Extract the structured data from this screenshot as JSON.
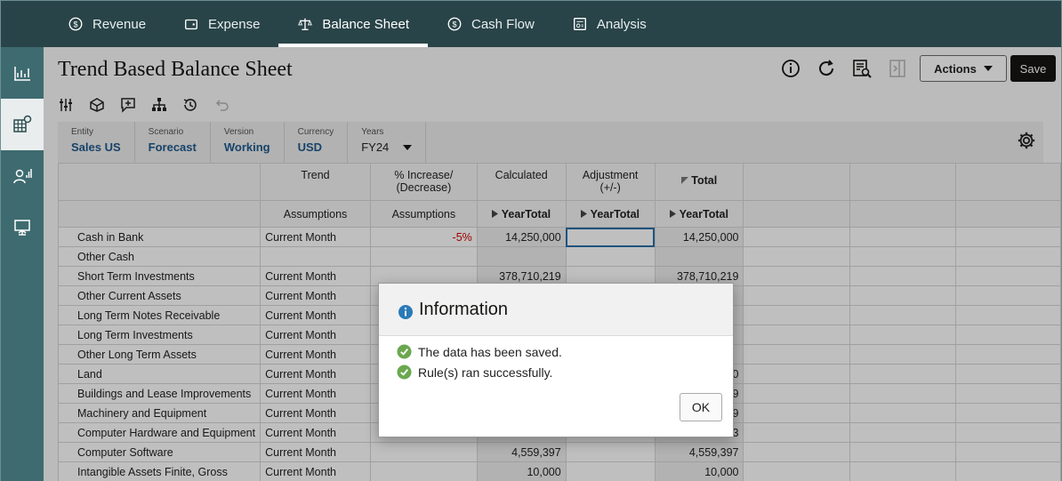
{
  "nav": {
    "tabs": [
      {
        "label": "Revenue",
        "icon": "dollar-circle-icon"
      },
      {
        "label": "Expense",
        "icon": "wallet-icon"
      },
      {
        "label": "Balance Sheet",
        "icon": "scale-icon",
        "active": true
      },
      {
        "label": "Cash Flow",
        "icon": "dollar-circle-icon"
      },
      {
        "label": "Analysis",
        "icon": "report-icon"
      }
    ]
  },
  "page": {
    "title": "Trend Based Balance Sheet",
    "actions_label": "Actions",
    "save_label": "Save"
  },
  "pov": [
    {
      "label": "Entity",
      "value": "Sales US"
    },
    {
      "label": "Scenario",
      "value": "Forecast"
    },
    {
      "label": "Version",
      "value": "Working"
    },
    {
      "label": "Currency",
      "value": "USD"
    },
    {
      "label": "Years",
      "value": "FY24"
    }
  ],
  "grid": {
    "headers1": [
      "",
      "Trend",
      "% Increase/ (Decrease)",
      "Calculated",
      "Adjustment (+/-)",
      "Total",
      "",
      "",
      ""
    ],
    "headers2": [
      "",
      "Assumptions",
      "Assumptions",
      "YearTotal",
      "YearTotal",
      "YearTotal",
      "",
      "",
      ""
    ],
    "rows": [
      {
        "name": "Cash in Bank",
        "trend": "Current Month",
        "pct": "-5%",
        "calc": "14,250,000",
        "adj": "",
        "total": "14,250,000"
      },
      {
        "name": "Other Cash",
        "trend": "",
        "pct": "",
        "calc": "",
        "adj": "",
        "total": ""
      },
      {
        "name": "Short Term Investments",
        "trend": "Current Month",
        "pct": "",
        "calc": "378,710,219",
        "adj": "",
        "total": "378,710,219"
      },
      {
        "name": "Other Current Assets",
        "trend": "Current Month",
        "pct": "",
        "calc": "",
        "adj": "",
        "total": ""
      },
      {
        "name": "Long Term Notes Receivable",
        "trend": "Current Month",
        "pct": "",
        "calc": "",
        "adj": "",
        "total": ""
      },
      {
        "name": "Long Term Investments",
        "trend": "Current Month",
        "pct": "",
        "calc": "",
        "adj": "",
        "total": ""
      },
      {
        "name": "Other Long Term Assets",
        "trend": "Current Month",
        "pct": "",
        "calc": "",
        "adj": "",
        "total": ""
      },
      {
        "name": "Land",
        "trend": "Current Month",
        "pct": "",
        "calc": "",
        "adj": "",
        "total": "0"
      },
      {
        "name": "Buildings and Lease Improvements",
        "trend": "Current Month",
        "pct": "",
        "calc": "",
        "adj": "",
        "total": "9"
      },
      {
        "name": "Machinery and Equipment",
        "trend": "Current Month",
        "pct": "",
        "calc": "",
        "adj": "",
        "total": "9"
      },
      {
        "name": "Computer Hardware and Equipment",
        "trend": "Current Month",
        "pct": "",
        "calc": "",
        "adj": "",
        "total": "3"
      },
      {
        "name": "Computer Software",
        "trend": "Current Month",
        "pct": "",
        "calc": "4,559,397",
        "adj": "",
        "total": "4,559,397"
      },
      {
        "name": "Intangible Assets Finite, Gross",
        "trend": "Current Month",
        "pct": "",
        "calc": "10,000",
        "adj": "",
        "total": "10,000"
      }
    ]
  },
  "dialog": {
    "title": "Information",
    "messages": [
      "The data has been saved.",
      "Rule(s) ran successfully."
    ],
    "ok_label": "OK"
  },
  "colors": {
    "nav_bg": "#294448",
    "rail_bg": "#3e6b70",
    "accent_blue": "#1f5a8c",
    "success_green": "#6aa84f",
    "info_blue": "#2a7ab8",
    "negative_red": "#d40000"
  }
}
